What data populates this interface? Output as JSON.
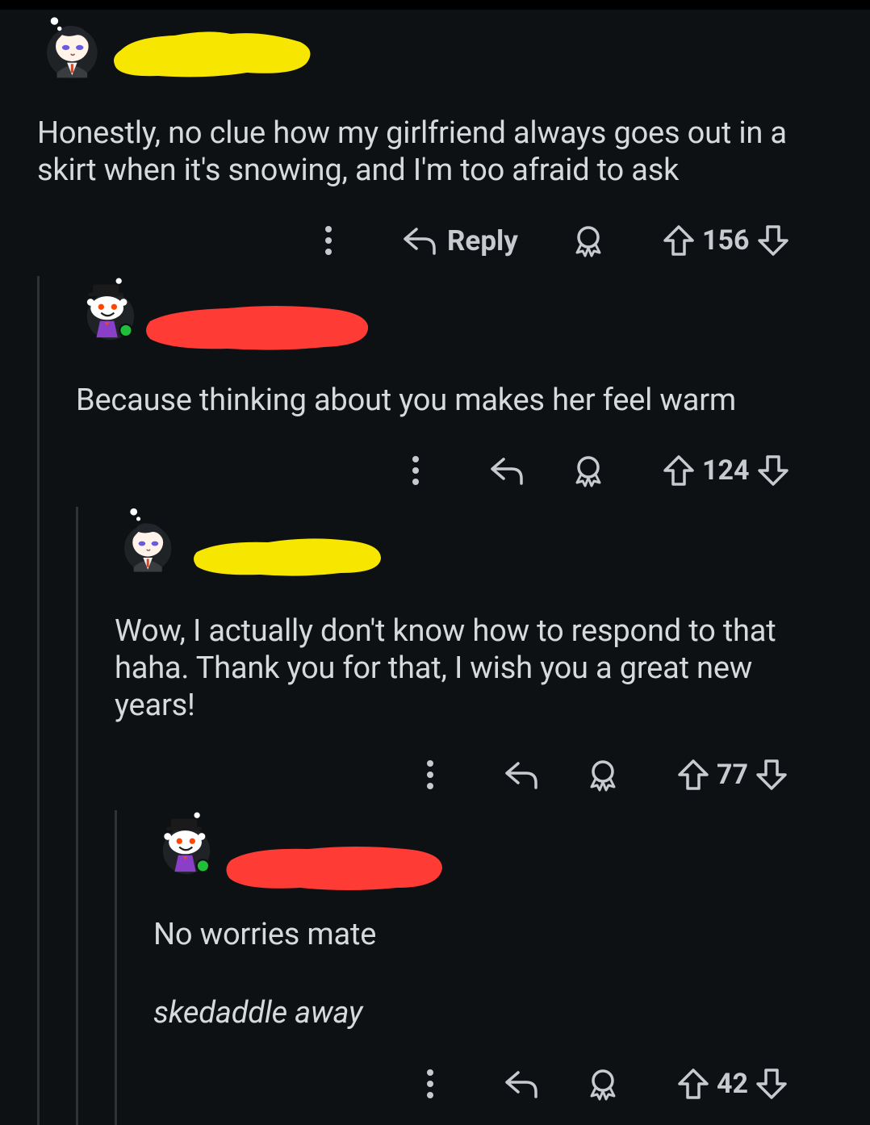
{
  "comments": [
    {
      "text": "Honestly, no clue how my girlfriend always goes out in a skirt when it's snowing, and I'm too afraid to ask",
      "reply_label": "Reply",
      "score": "156",
      "username_redaction_color": "#f7e600"
    },
    {
      "text": "Because thinking about you makes her feel warm",
      "score": "124",
      "username_redaction_color": "#ff3b36",
      "online": true
    },
    {
      "text": "Wow, I actually don't know how to respond to that haha. Thank you for that, I wish you a great new years!",
      "score": "77",
      "username_redaction_color": "#f7e600"
    },
    {
      "text": "No worries mate",
      "text_italic": "skedaddle away",
      "score": "42",
      "username_redaction_color": "#ff3b36",
      "online": true
    }
  ],
  "colors": {
    "background": "#0e1114",
    "text": "#d7dadc",
    "icon": "#c7cbcf",
    "thread_line": "#2f3336",
    "online": "#1fbf3a"
  },
  "icons": [
    "more-icon",
    "reply-icon",
    "award-icon",
    "upvote-icon",
    "downvote-icon"
  ]
}
